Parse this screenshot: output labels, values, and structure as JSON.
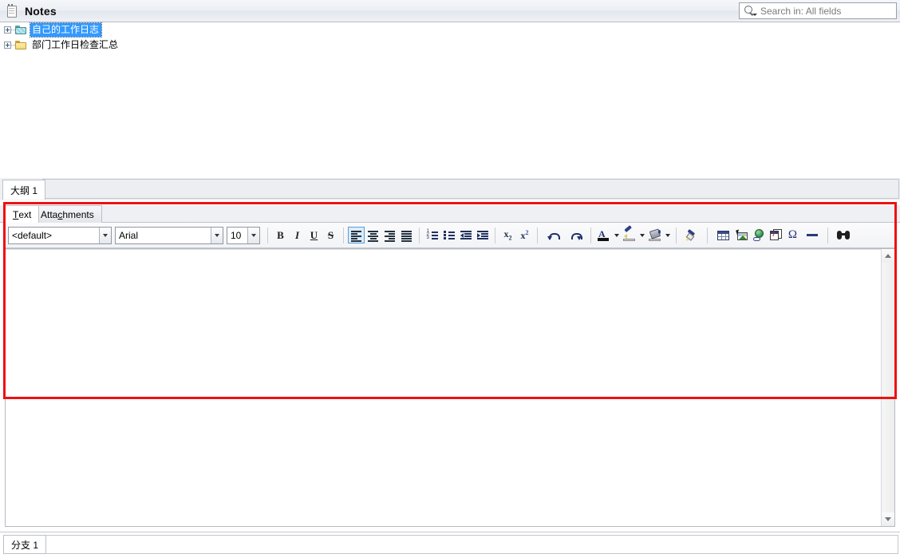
{
  "header": {
    "icon": "notepad-icon",
    "title": "Notes",
    "search": {
      "icon": "search-icon",
      "placeholder": "Search in: All fields",
      "value": ""
    }
  },
  "tree": {
    "items": [
      {
        "label": "自己的工作日志",
        "icon": "folder-cyan-icon",
        "selected": true,
        "expander": "plus"
      },
      {
        "label": "部门工作日检查汇总",
        "icon": "folder-yellow-icon",
        "selected": false,
        "expander": "plus"
      }
    ]
  },
  "outline_tabs": {
    "items": [
      {
        "label": "大纲 1",
        "active": true
      }
    ]
  },
  "editor": {
    "tabs": [
      {
        "label": "Text",
        "accel_index": 0,
        "active": true
      },
      {
        "label": "Attachments",
        "accel_index": 4,
        "active": false
      }
    ],
    "toolbar": {
      "style_combo": {
        "value": "<default>",
        "name": "paragraph-style-combo"
      },
      "font_combo": {
        "value": "Arial",
        "name": "font-family-combo"
      },
      "size_combo": {
        "value": "10",
        "name": "font-size-combo"
      },
      "buttons": [
        {
          "name": "bold-button",
          "label": "B"
        },
        {
          "name": "italic-button",
          "label": "I"
        },
        {
          "name": "underline-button",
          "label": "U"
        },
        {
          "name": "strikethrough-button",
          "label": "S"
        },
        {
          "name": "align-left-button",
          "label": "Align Left",
          "active": true
        },
        {
          "name": "align-center-button",
          "label": "Align Center"
        },
        {
          "name": "align-right-button",
          "label": "Align Right"
        },
        {
          "name": "align-justify-button",
          "label": "Justify"
        },
        {
          "name": "numbered-list-button",
          "label": "Numbered List"
        },
        {
          "name": "bulleted-list-button",
          "label": "Bulleted List"
        },
        {
          "name": "decrease-indent-button",
          "label": "Decrease Indent"
        },
        {
          "name": "increase-indent-button",
          "label": "Increase Indent"
        },
        {
          "name": "subscript-button",
          "label": "Subscript"
        },
        {
          "name": "superscript-button",
          "label": "Superscript"
        },
        {
          "name": "undo-button",
          "label": "Undo"
        },
        {
          "name": "redo-button",
          "label": "Redo"
        },
        {
          "name": "font-color-button",
          "label": "Font Color"
        },
        {
          "name": "highlight-color-button",
          "label": "Highlight Color"
        },
        {
          "name": "background-color-button",
          "label": "Background Color"
        },
        {
          "name": "format-painter-button",
          "label": "Format Painter"
        },
        {
          "name": "insert-table-button",
          "label": "Insert Table"
        },
        {
          "name": "insert-image-button",
          "label": "Insert Image"
        },
        {
          "name": "insert-hyperlink-button",
          "label": "Insert Hyperlink"
        },
        {
          "name": "insert-date-button",
          "label": "Insert Date"
        },
        {
          "name": "insert-symbol-button",
          "label": "Insert Symbol"
        },
        {
          "name": "insert-horizontal-line-button",
          "label": "Horizontal Line"
        },
        {
          "name": "find-button",
          "label": "Find"
        }
      ]
    },
    "content": "",
    "date_icon_number": "7"
  },
  "bottom_tabs": {
    "items": [
      {
        "label": "分支 1",
        "active": true
      }
    ]
  },
  "annotation": {
    "type": "red-rectangle-highlight",
    "color": "#ee1111"
  }
}
